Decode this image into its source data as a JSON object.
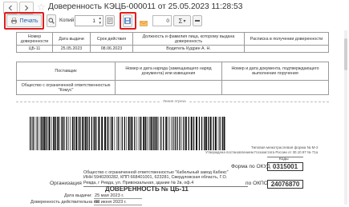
{
  "window": {
    "title": "Доверенность КЭЦБ-000011 от 25.05.2023 11:28:53"
  },
  "toolbar": {
    "print_label": "Печать",
    "copies_label": "Копий:",
    "copies_value": "1",
    "number_value": "0",
    "sum_symbol": "Σ",
    "arrow_down": "▾"
  },
  "header_table": {
    "row1": [
      "Номер доверенности",
      "Дата выдачи",
      "Срок действия",
      "Должность и фамилия лица, которому выдана доверенность",
      "Расписка в получении доверенности"
    ],
    "row2": [
      "ЦБ-11",
      "25.05.2023",
      "08.06.2023",
      "Водитель Кудрин А. Н.",
      ""
    ],
    "row3": [
      "Поставщик",
      "Номер и дата наряда (замещающего наряд документа) или извещения",
      "Номер и дата документа, подтверждающего выполнение поручения"
    ],
    "row4": [
      "Общество с ограниченной ответственностью \"Комус\"",
      "",
      ""
    ]
  },
  "cut_line": "Линия отреза",
  "form": {
    "approval": "Типовая межотраслевая форма № М-2",
    "approval2": "Утверждена постановлением Госкомстата России от 30.10.97 № 71а",
    "codes_label": "Коды",
    "okud_label": "Форма по ОКУД",
    "okud_value": "0315001",
    "okpo_label": "по ОКПО",
    "okpo_value": "24076870",
    "org_label": "Организация",
    "org_line1": "Общество с ограниченной ответственностью \"Кабельный завод Кабекс\"",
    "org_line2": "ИНН 5940200282, КПП 668401001, 623281, Свердловская область, Г.О.",
    "org_line3": "Ревда, г Ревда, ул. Привокзальная, здание № 2в, оф.4",
    "title": "ДОВЕРЕННОСТЬ № ЦБ-11",
    "issue_label": "Дата выдачи:",
    "issue_value": "25 мая 2023 г.",
    "valid_label": "Доверенность действительна по:",
    "valid_value": "08 июня 2023 г."
  },
  "colors": {
    "highlight": "#e11d1d",
    "print_text": "#1a5fb4",
    "code_border": "#333333"
  }
}
